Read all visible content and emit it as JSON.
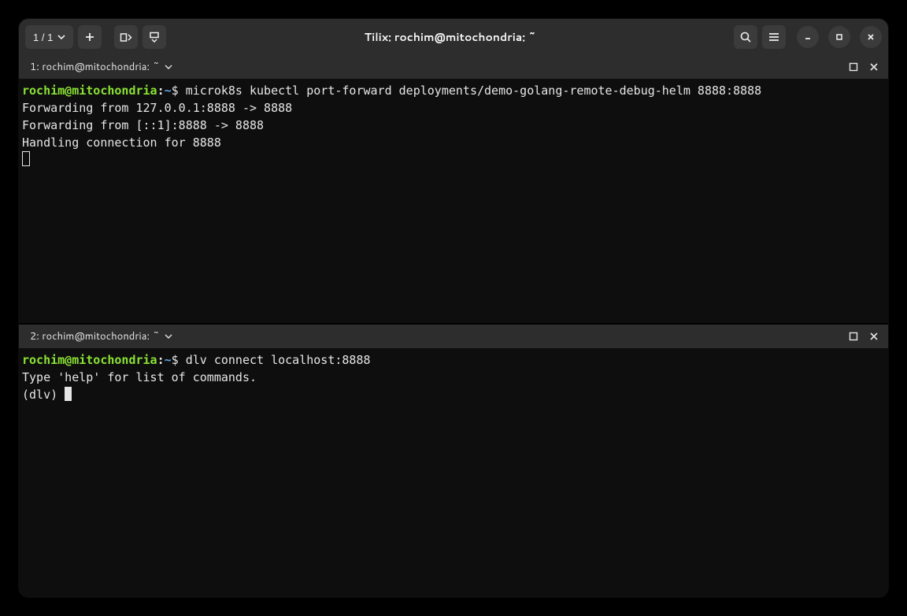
{
  "titlebar": {
    "session_label": "1 / 1",
    "window_title": "Tilix: rochim@mitochondria: ~"
  },
  "panes": [
    {
      "title": "1: rochim@mitochondria: ~",
      "prompt": {
        "user_host": "rochim@mitochondria",
        "path": "~",
        "symbol": "$"
      },
      "command": "microk8s kubectl port-forward deployments/demo-golang-remote-debug-helm 8888:8888",
      "output": [
        "Forwarding from 127.0.0.1:8888 -> 8888",
        "Forwarding from [::1]:8888 -> 8888",
        "Handling connection for 8888"
      ]
    },
    {
      "title": "2: rochim@mitochondria: ~",
      "prompt": {
        "user_host": "rochim@mitochondria",
        "path": "~",
        "symbol": "$"
      },
      "command": "dlv connect localhost:8888",
      "output": [
        "Type 'help' for list of commands."
      ],
      "repl_prompt": "(dlv) "
    }
  ]
}
